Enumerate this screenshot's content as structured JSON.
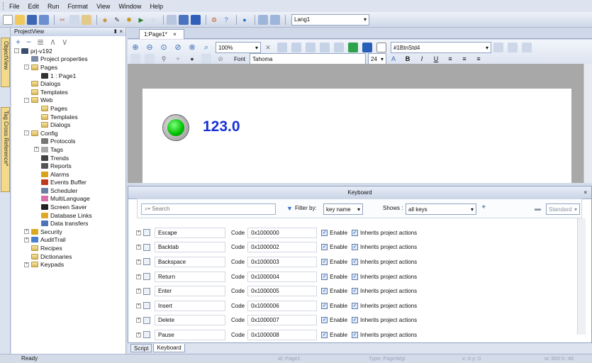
{
  "menu": [
    "File",
    "Edit",
    "Run",
    "Format",
    "View",
    "Window",
    "Help"
  ],
  "toolbar": {
    "lang_value": "Lang1"
  },
  "sidebar_tabs": [
    "ObjectView",
    "Tag Cross Reference*"
  ],
  "project_view": {
    "title": "ProjectView",
    "pin": "⬍ ×",
    "tree": [
      {
        "label": "prj-v192",
        "level": 0,
        "exp": "-",
        "icon": "monitor"
      },
      {
        "label": "Project properties",
        "level": 1,
        "icon": "props"
      },
      {
        "label": "Pages",
        "level": 1,
        "exp": "-",
        "icon": "folder"
      },
      {
        "label": "1 : Page1",
        "level": 2,
        "icon": "page"
      },
      {
        "label": "Dialogs",
        "level": 1,
        "icon": "folder"
      },
      {
        "label": "Templates",
        "level": 1,
        "icon": "folder"
      },
      {
        "label": "Web",
        "level": 1,
        "exp": "-",
        "icon": "folder"
      },
      {
        "label": "Pages",
        "level": 2,
        "icon": "folder"
      },
      {
        "label": "Templates",
        "level": 2,
        "icon": "folder"
      },
      {
        "label": "Dialogs",
        "level": 2,
        "icon": "folder"
      },
      {
        "label": "Config",
        "level": 1,
        "exp": "-",
        "icon": "folder"
      },
      {
        "label": "Protocols",
        "level": 2,
        "icon": "proto"
      },
      {
        "label": "Tags",
        "level": 2,
        "exp": "+",
        "icon": "tags"
      },
      {
        "label": "Trends",
        "level": 2,
        "icon": "trend"
      },
      {
        "label": "Reports",
        "level": 2,
        "icon": "report"
      },
      {
        "label": "Alarms",
        "level": 2,
        "icon": "alarm"
      },
      {
        "label": "Events Buffer",
        "level": 2,
        "icon": "events"
      },
      {
        "label": "Scheduler",
        "level": 2,
        "icon": "sched"
      },
      {
        "label": "MultiLanguage",
        "level": 2,
        "icon": "lang"
      },
      {
        "label": "Screen Saver",
        "level": 2,
        "icon": "screen"
      },
      {
        "label": "Database Links",
        "level": 2,
        "icon": "db"
      },
      {
        "label": "Data transfers",
        "level": 2,
        "icon": "transfer"
      },
      {
        "label": "Security",
        "level": 1,
        "exp": "+",
        "icon": "security"
      },
      {
        "label": "AuditTrail",
        "level": 1,
        "exp": "+",
        "icon": "audit"
      },
      {
        "label": "Recipes",
        "level": 1,
        "icon": "folder"
      },
      {
        "label": "Dictionaries",
        "level": 1,
        "icon": "folder"
      },
      {
        "label": "Keypads",
        "level": 1,
        "exp": "+",
        "icon": "folder"
      }
    ]
  },
  "document_tab": {
    "label": "1:Page1*",
    "close": "×"
  },
  "editor_toolbar": {
    "zoom": "100%",
    "style_combo": "#1BtnStd4",
    "font_label": "Font",
    "font_name": "Tahoma",
    "font_size": "24"
  },
  "canvas": {
    "value_text": "123.0",
    "led_color": "#00c000",
    "value_color": "#1830d8"
  },
  "keyboard": {
    "title": "Keyboard",
    "close": "×",
    "search_placeholder": "Search",
    "filter_label": "Filter by:",
    "filter_value": "key name",
    "shows_label": "Shows :",
    "shows_value": "all keys",
    "standard_label": "Standard",
    "code_label": "Code",
    "enable_label": "Enable",
    "inherits_label": "Inherits project actions",
    "rows": [
      {
        "name": "Escape",
        "code": "0x1000000"
      },
      {
        "name": "Backtab",
        "code": "0x1000002"
      },
      {
        "name": "Backspace",
        "code": "0x1000003"
      },
      {
        "name": "Return",
        "code": "0x1000004"
      },
      {
        "name": "Enter",
        "code": "0x1000005"
      },
      {
        "name": "Insert",
        "code": "0x1000006"
      },
      {
        "name": "Delete",
        "code": "0x1000007"
      },
      {
        "name": "Pause",
        "code": "0x1000008"
      }
    ]
  },
  "bottom_tabs": [
    "Script",
    "Keyboard"
  ],
  "status": {
    "text": "Ready",
    "id": "id: Page1",
    "type": "Type: PageWgt",
    "coords": "x: 0   y: 0",
    "size": "w: 800   h: 48"
  }
}
